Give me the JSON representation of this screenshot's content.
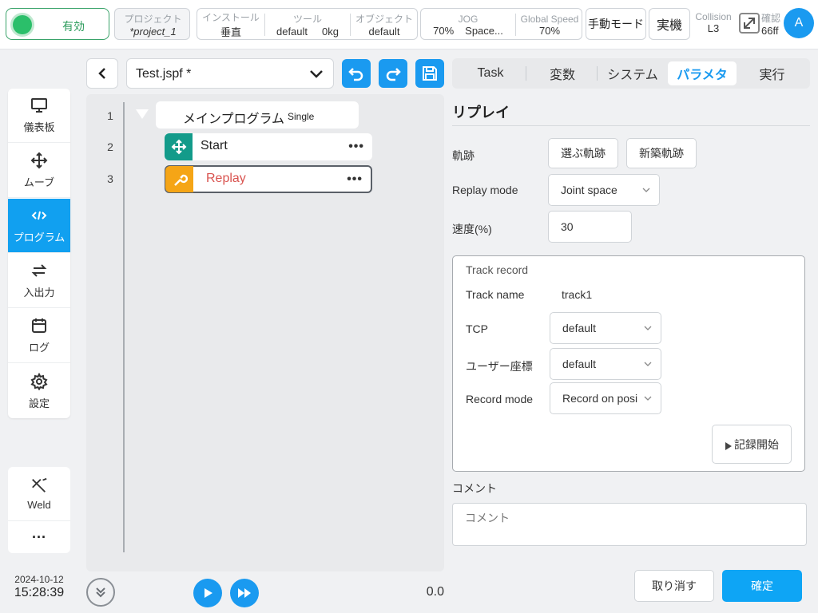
{
  "topbar": {
    "enable_label": "有効",
    "project_label": "プロジェクト",
    "project_value": "*project_1",
    "install_label": "インストール",
    "install_value": "垂直",
    "tool_label": "ツール",
    "tool_value": "default",
    "tool_weight": "0kg",
    "object_label": "オブジェクト",
    "object_value": "default",
    "jog_label": "JOG",
    "jog_value": "70%",
    "jog_space": "Space...",
    "speed_label": "Global Speed",
    "speed_value": "70%",
    "manual_mode_label": "手動モード",
    "real_machine_label": "実機",
    "collision_label": "Collision",
    "collision_value": "L3",
    "confirm_label": "確認",
    "confirm_value": "66ff",
    "avatar_letter": "A"
  },
  "nav": {
    "items": [
      {
        "label": "儀表板",
        "icon": "monitor-icon"
      },
      {
        "label": "ムーブ",
        "icon": "move-arrows-icon"
      },
      {
        "label": "プログラム",
        "icon": "code-icon"
      },
      {
        "label": "入出力",
        "icon": "swap-icon"
      },
      {
        "label": "ログ",
        "icon": "calendar-icon"
      },
      {
        "label": "設定",
        "icon": "gear-icon"
      }
    ],
    "weld_label": "Weld",
    "more_label": "···"
  },
  "datetime": {
    "date": "2024-10-12",
    "time": "15:28:39"
  },
  "editor": {
    "file_name": "Test.jspf *",
    "lines": [
      "1",
      "2",
      "3"
    ],
    "main_program_label": "メインプログラム",
    "main_program_mode": "Single",
    "start_label": "Start",
    "replay_label": "Replay",
    "progress_value": "0.0"
  },
  "tabs": [
    "Task",
    "変数",
    "システム",
    "パラメタ",
    "実行"
  ],
  "panel": {
    "title": "リプレイ",
    "trajectory_label": "軌跡",
    "choose_trajectory": "選ぶ軌跡",
    "new_trajectory": "新築軌跡",
    "replay_mode_label": "Replay mode",
    "replay_mode_value": "Joint space",
    "speed_label": "速度(%)",
    "speed_value": "30",
    "track_record_title": "Track record",
    "track_name_label": "Track name",
    "track_name_value": "track1",
    "tcp_label": "TCP",
    "tcp_value": "default",
    "user_coord_label": "ユーザー座標",
    "user_coord_value": "default",
    "record_mode_label": "Record mode",
    "record_mode_value": "Record on posi",
    "record_start_label": "記録開始",
    "comment_label": "コメント",
    "comment_placeholder": "コメント",
    "cancel_label": "取り消す",
    "ok_label": "確定"
  },
  "colors": {
    "accent": "#1a9af0",
    "enable_green": "#2bbf6a",
    "start_teal": "#139b8a",
    "replay_orange": "#f5a516",
    "replay_text": "#d9534f"
  }
}
